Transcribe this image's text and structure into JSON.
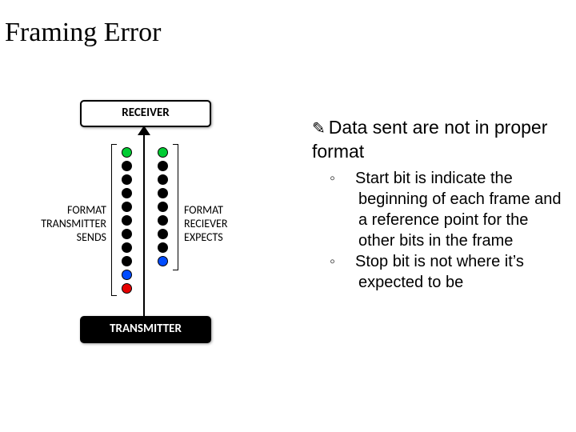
{
  "title": "Framing Error",
  "receiver_label": "RECEIVER",
  "transmitter_label": "TRANSMITTER",
  "tx_side_label_l1": "FORMAT",
  "tx_side_label_l2": "TRANSMITTER",
  "tx_side_label_l3": "SENDS",
  "rx_side_label_l1": "FORMAT",
  "rx_side_label_l2": "RECIEVER",
  "rx_side_label_l3": "EXPECTS",
  "main_bullet": "Data sent are not in proper format",
  "sub_bullet_1": "Start bit is indicate the beginning of each frame and a reference point for the other bits in the frame",
  "sub_bullet_2": "Stop bit is not where it’s expected to be",
  "left_dots": [
    "green",
    "black",
    "black",
    "black",
    "black",
    "black",
    "black",
    "black",
    "black",
    "blue",
    "red"
  ],
  "right_dots": [
    "green",
    "black",
    "black",
    "black",
    "black",
    "black",
    "black",
    "black",
    "blue"
  ]
}
